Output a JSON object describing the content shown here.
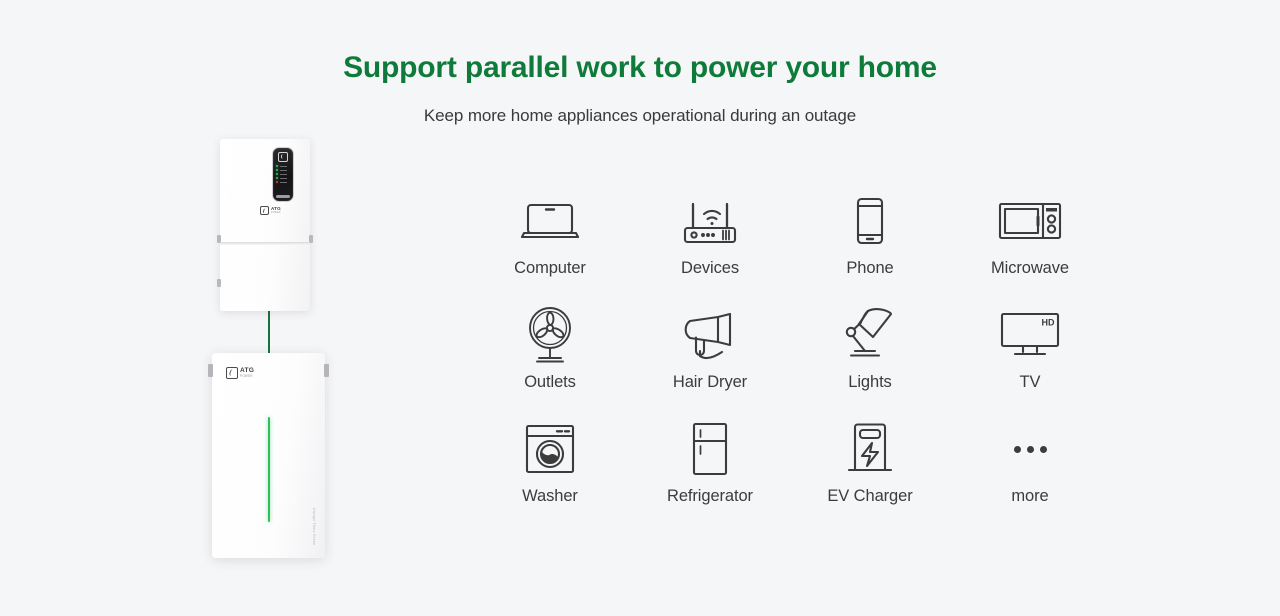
{
  "header": {
    "title": "Support parallel work to power your home",
    "subtitle": "Keep more home appliances operational during an outage",
    "title_color": "#0f7b3b",
    "subtitle_color": "#3a3a3a"
  },
  "background_color": "#f5f6f7",
  "product": {
    "inverter": {
      "name": "inverter-unit",
      "brand": "ATG",
      "brand_sub": "POWER",
      "display_indicator_color": "#2ecb5b",
      "alert_indicator_color": "#d8413a"
    },
    "battery": {
      "name": "battery-unit",
      "brand": "ATG",
      "brand_sub": "POWER",
      "tagline": "Always Think Green",
      "led_strip_color": "#2fbe5c"
    },
    "connector_color": "#18733f"
  },
  "appliances": [
    {
      "label": "Computer",
      "icon": "laptop-icon"
    },
    {
      "label": "Devices",
      "icon": "wifi-router-icon"
    },
    {
      "label": "Phone",
      "icon": "smartphone-icon"
    },
    {
      "label": "Microwave",
      "icon": "microwave-icon"
    },
    {
      "label": "Outlets",
      "icon": "fan-icon"
    },
    {
      "label": "Hair Dryer",
      "icon": "hair-dryer-icon"
    },
    {
      "label": "Lights",
      "icon": "desk-lamp-icon"
    },
    {
      "label": "TV",
      "icon": "television-icon"
    },
    {
      "label": "Washer",
      "icon": "washing-machine-icon"
    },
    {
      "label": "Refrigerator",
      "icon": "refrigerator-icon"
    },
    {
      "label": "EV Charger",
      "icon": "ev-charger-icon"
    },
    {
      "label": "more",
      "icon": "ellipsis-icon"
    }
  ],
  "tv_badge": "HD",
  "icon_stroke_color": "#3c3c3c"
}
